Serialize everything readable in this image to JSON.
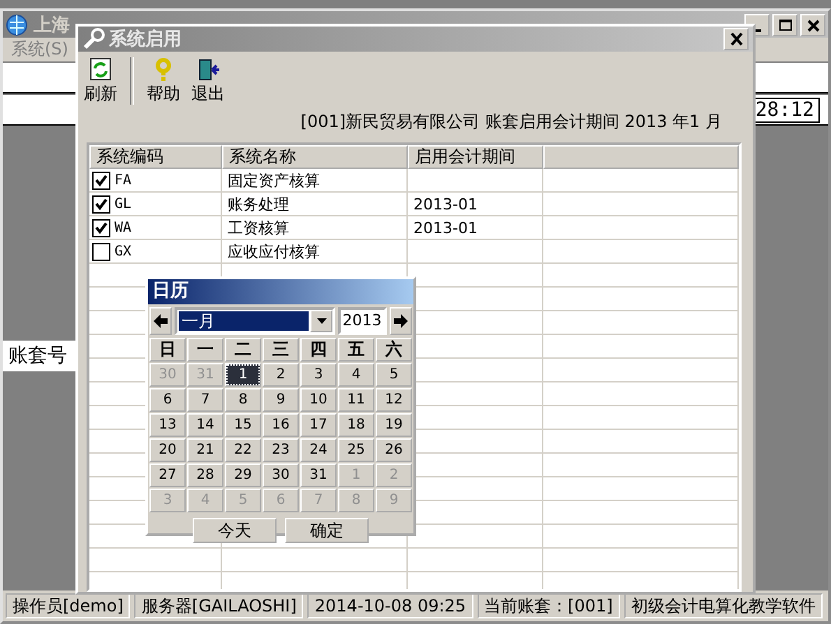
{
  "main_window": {
    "title": "上海",
    "menu": [
      "系统(S)"
    ],
    "clock": "28:12",
    "side_label": "账套号",
    "status_bar": [
      "操作员[demo]",
      "服务器[GAILAOSHI]",
      "2014-10-08 09:25",
      "当前账套：[001]",
      "初级会计电算化教学软件"
    ]
  },
  "dialog": {
    "title": "系统启用",
    "toolbar": [
      {
        "kind": "refresh",
        "label": "刷新"
      },
      {
        "kind": "help",
        "label": "帮助"
      },
      {
        "kind": "exit",
        "label": "退出"
      }
    ],
    "info": "[001]新民贸易有限公司 账套启用会计期间 2013 年1 月",
    "table": {
      "columns": [
        "系统编码",
        "系统名称",
        "启用会计期间"
      ],
      "rows": [
        {
          "code": "FA",
          "name": "固定资产核算",
          "period": "",
          "checked": true
        },
        {
          "code": "GL",
          "name": "账务处理",
          "period": "2013-01",
          "checked": true
        },
        {
          "code": "WA",
          "name": "工资核算",
          "period": "2013-01",
          "checked": true
        },
        {
          "code": "GX",
          "name": "应收应付核算",
          "period": "",
          "checked": false
        }
      ]
    }
  },
  "calendar": {
    "title": "日历",
    "month": "一月",
    "year": "2013",
    "weekdays": [
      "日",
      "一",
      "二",
      "三",
      "四",
      "五",
      "六"
    ],
    "days": [
      {
        "day": "30",
        "muted": true,
        "selected": false
      },
      {
        "day": "31",
        "muted": true,
        "selected": false
      },
      {
        "day": "1",
        "muted": false,
        "selected": true
      },
      {
        "day": "2",
        "muted": false,
        "selected": false
      },
      {
        "day": "3",
        "muted": false,
        "selected": false
      },
      {
        "day": "4",
        "muted": false,
        "selected": false
      },
      {
        "day": "5",
        "muted": false,
        "selected": false
      },
      {
        "day": "6",
        "muted": false,
        "selected": false
      },
      {
        "day": "7",
        "muted": false,
        "selected": false
      },
      {
        "day": "8",
        "muted": false,
        "selected": false
      },
      {
        "day": "9",
        "muted": false,
        "selected": false
      },
      {
        "day": "10",
        "muted": false,
        "selected": false
      },
      {
        "day": "11",
        "muted": false,
        "selected": false
      },
      {
        "day": "12",
        "muted": false,
        "selected": false
      },
      {
        "day": "13",
        "muted": false,
        "selected": false
      },
      {
        "day": "14",
        "muted": false,
        "selected": false
      },
      {
        "day": "15",
        "muted": false,
        "selected": false
      },
      {
        "day": "16",
        "muted": false,
        "selected": false
      },
      {
        "day": "17",
        "muted": false,
        "selected": false
      },
      {
        "day": "18",
        "muted": false,
        "selected": false
      },
      {
        "day": "19",
        "muted": false,
        "selected": false
      },
      {
        "day": "20",
        "muted": false,
        "selected": false
      },
      {
        "day": "21",
        "muted": false,
        "selected": false
      },
      {
        "day": "22",
        "muted": false,
        "selected": false
      },
      {
        "day": "23",
        "muted": false,
        "selected": false
      },
      {
        "day": "24",
        "muted": false,
        "selected": false
      },
      {
        "day": "25",
        "muted": false,
        "selected": false
      },
      {
        "day": "26",
        "muted": false,
        "selected": false
      },
      {
        "day": "27",
        "muted": false,
        "selected": false
      },
      {
        "day": "28",
        "muted": false,
        "selected": false
      },
      {
        "day": "29",
        "muted": false,
        "selected": false
      },
      {
        "day": "30",
        "muted": false,
        "selected": false
      },
      {
        "day": "31",
        "muted": false,
        "selected": false
      },
      {
        "day": "1",
        "muted": true,
        "selected": false
      },
      {
        "day": "2",
        "muted": true,
        "selected": false
      },
      {
        "day": "3",
        "muted": true,
        "selected": false
      },
      {
        "day": "4",
        "muted": true,
        "selected": false
      },
      {
        "day": "5",
        "muted": true,
        "selected": false
      },
      {
        "day": "6",
        "muted": true,
        "selected": false
      },
      {
        "day": "7",
        "muted": true,
        "selected": false
      },
      {
        "day": "8",
        "muted": true,
        "selected": false
      },
      {
        "day": "9",
        "muted": true,
        "selected": false
      }
    ],
    "buttons": [
      "今天",
      "确定"
    ]
  }
}
